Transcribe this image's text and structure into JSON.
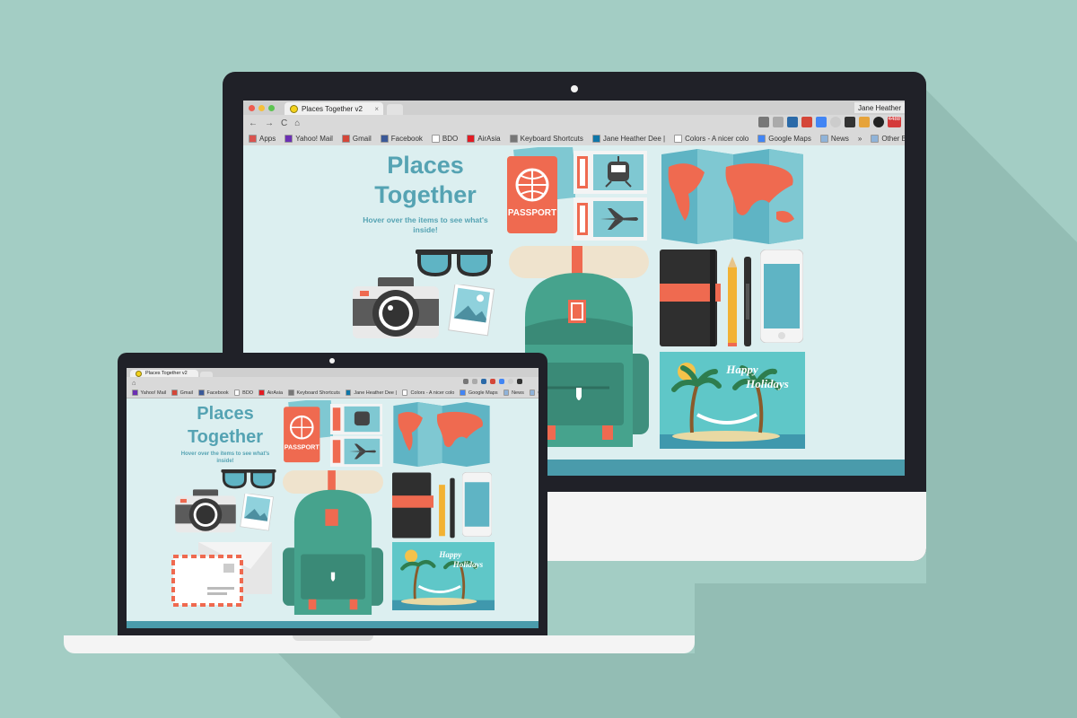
{
  "browser": {
    "tab_title": "Places Together v2",
    "tab_close": "×",
    "user_name": "Jane Heather",
    "nav": {
      "back": "←",
      "forward": "→",
      "reload": "C",
      "home": "⌂"
    },
    "bookmarks_desktop": [
      {
        "label": "Apps",
        "color": "#d9534f"
      },
      {
        "label": "Yahoo! Mail",
        "color": "#6b2fb3"
      },
      {
        "label": "Gmail",
        "color": "#d44638"
      },
      {
        "label": "Facebook",
        "color": "#3b5998"
      },
      {
        "label": "BDO",
        "color": "#ffffff"
      },
      {
        "label": "AirAsia",
        "color": "#e21b23"
      },
      {
        "label": "Keyboard Shortcuts",
        "color": "#777777"
      },
      {
        "label": "Jane Heather Dee |",
        "color": "#0e76a8"
      },
      {
        "label": "Colors - A nicer colo",
        "color": "#ffffff"
      },
      {
        "label": "Google Maps",
        "color": "#4285f4"
      },
      {
        "label": "News",
        "color": "#8fb3d9"
      },
      {
        "label": "»",
        "color": ""
      },
      {
        "label": "Other Bookmarks",
        "color": "#8fb3d9"
      }
    ],
    "bookmarks_laptop": [
      {
        "label": "Yahoo! Mail",
        "color": "#6b2fb3"
      },
      {
        "label": "Gmail",
        "color": "#d44638"
      },
      {
        "label": "Facebook",
        "color": "#3b5998"
      },
      {
        "label": "BDO",
        "color": "#ffffff"
      },
      {
        "label": "AirAsia",
        "color": "#e21b23"
      },
      {
        "label": "Keyboard Shortcuts",
        "color": "#777777"
      },
      {
        "label": "Jane Heather Dee |",
        "color": "#0e76a8"
      },
      {
        "label": "Colors - A nicer colo",
        "color": "#ffffff"
      },
      {
        "label": "Google Maps",
        "color": "#4285f4"
      },
      {
        "label": "News",
        "color": "#8fb3d9"
      },
      {
        "label": "Ot",
        "color": "#8fb3d9"
      }
    ]
  },
  "page": {
    "title_line1": "Places",
    "title_line2": "Together",
    "subtitle": "Hover over the items to see what's inside!",
    "passport_label": "PASSPORT",
    "postcard_line1": "Happy",
    "postcard_line2": "Holidays",
    "badge": "4488"
  },
  "colors": {
    "background": "#a3cdc4",
    "page_bg": "#dceff0",
    "title": "#55a3b3",
    "coral": "#ef6a50",
    "teal_dark": "#3f8f7d"
  }
}
